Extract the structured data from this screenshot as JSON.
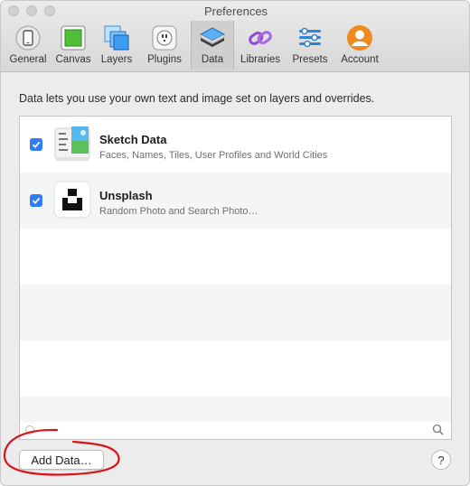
{
  "window": {
    "title": "Preferences"
  },
  "toolbar": {
    "items": [
      {
        "label": "General",
        "icon": "phone-icon"
      },
      {
        "label": "Canvas",
        "icon": "canvas-icon"
      },
      {
        "label": "Layers",
        "icon": "layers-icon"
      },
      {
        "label": "Plugins",
        "icon": "plug-icon"
      },
      {
        "label": "Data",
        "icon": "data-icon",
        "active": true
      },
      {
        "label": "Libraries",
        "icon": "link-icon"
      },
      {
        "label": "Presets",
        "icon": "sliders-icon"
      },
      {
        "label": "Account",
        "icon": "account-icon"
      }
    ]
  },
  "main": {
    "description": "Data lets you use your own text and image set on layers and overrides.",
    "data_sources": [
      {
        "title": "Sketch Data",
        "subtitle": "Faces, Names, Tiles, User Profiles and World Cities",
        "checked": true
      },
      {
        "title": "Unsplash",
        "subtitle": "Random Photo and Search Photo…",
        "checked": true
      }
    ]
  },
  "footer": {
    "add_button_label": "Add Data…",
    "help_label": "?"
  },
  "colors": {
    "accent": "#2f7cf6",
    "annotation": "#d8141b",
    "active_tab": "#cfcfcf"
  }
}
